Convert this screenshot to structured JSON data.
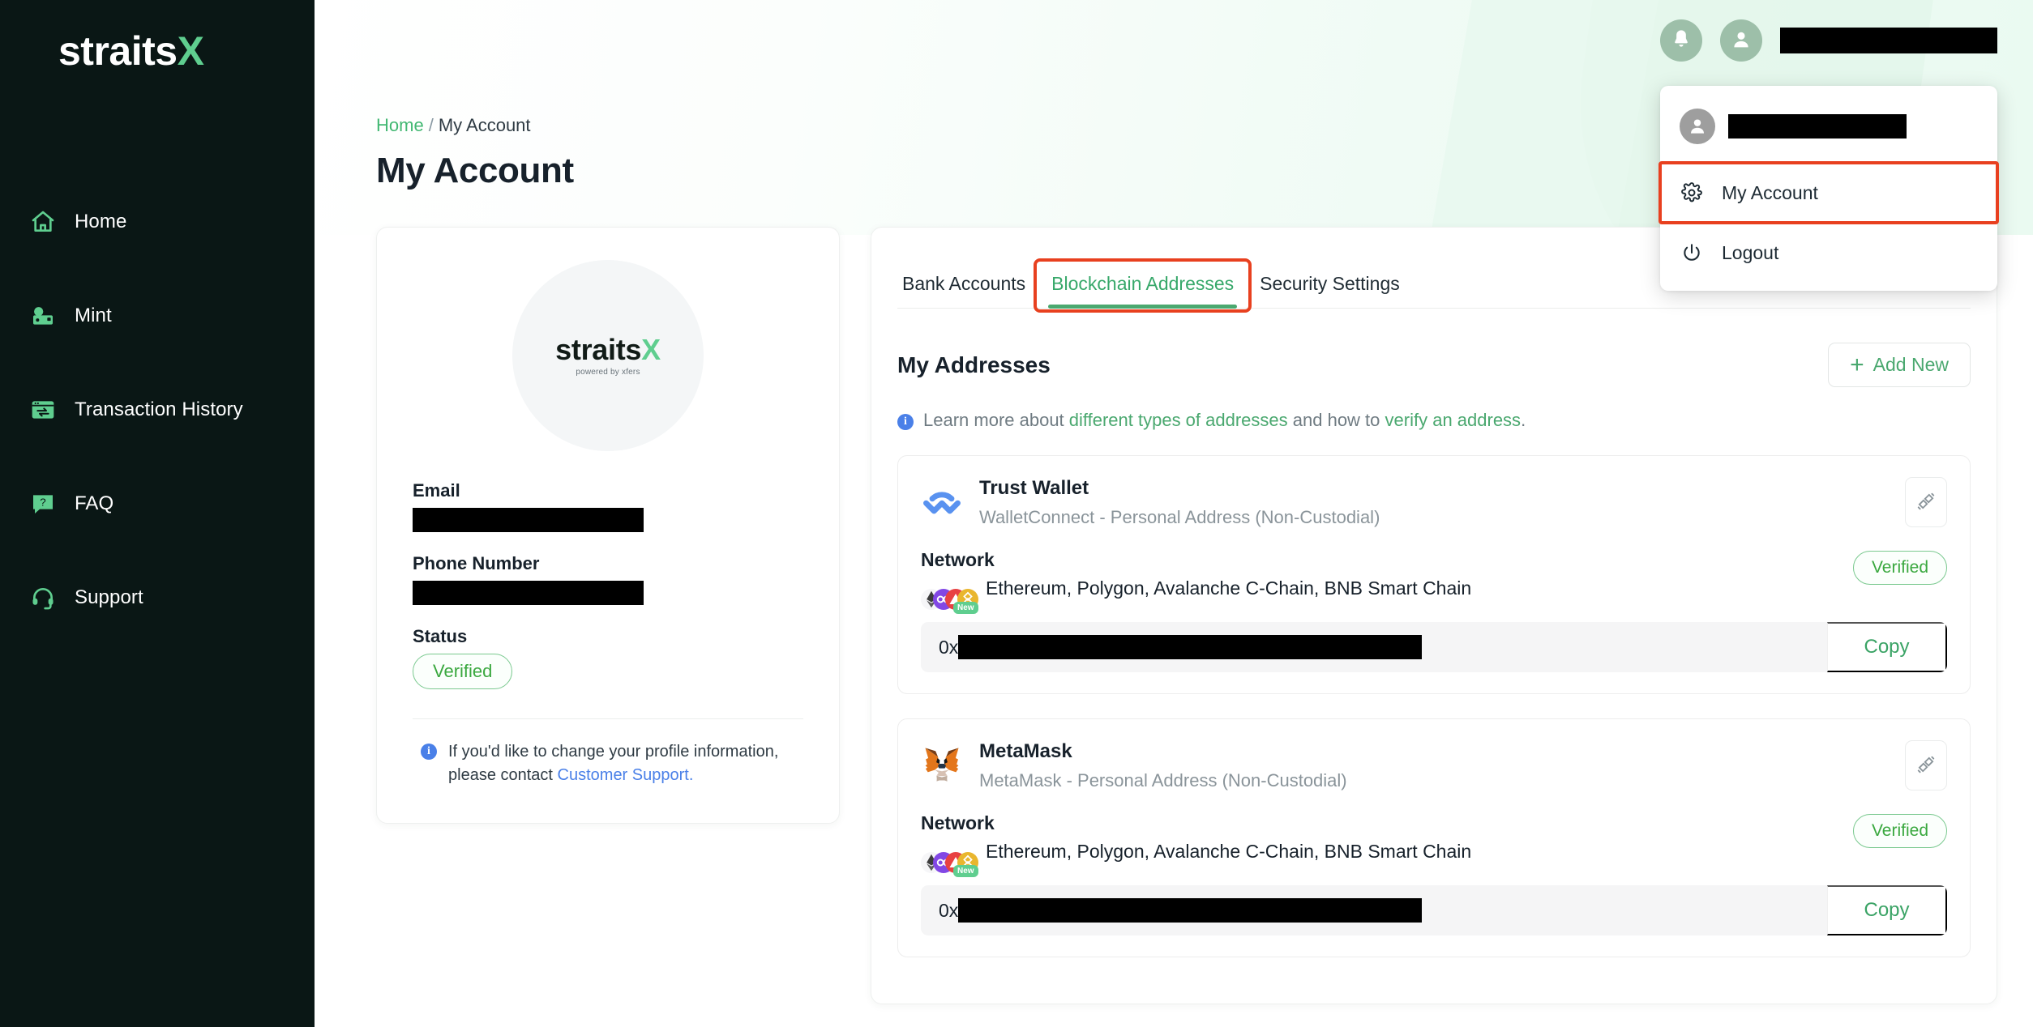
{
  "brand": {
    "logo_text": "straits",
    "logo_accent": "X",
    "avatar_logo_text": "straits",
    "avatar_logo_accent": "X",
    "avatar_tagline": "powered by xfers",
    "accent_green": "#5fce8f",
    "link_green": "#4aa86f",
    "highlight_red": "#e8401f",
    "sidebar_bg": "#0a1715"
  },
  "sidebar": {
    "items": [
      {
        "label": "Home",
        "icon": "home-icon"
      },
      {
        "label": "Mint",
        "icon": "money-icon"
      },
      {
        "label": "Transaction History",
        "icon": "transaction-history-icon"
      },
      {
        "label": "FAQ",
        "icon": "faq-icon"
      },
      {
        "label": "Support",
        "icon": "headset-icon"
      }
    ]
  },
  "topbar": {
    "notification_icon": "bell-icon",
    "profile_icon": "person-icon",
    "user_name": ""
  },
  "dropdown": {
    "avatar_icon": "person-icon",
    "user_name": "",
    "items": [
      {
        "label": "My Account",
        "icon": "gear-icon",
        "highlighted": true
      },
      {
        "label": "Logout",
        "icon": "power-icon",
        "highlighted": false
      }
    ]
  },
  "breadcrumb": {
    "home": "Home",
    "separator": "/",
    "current": "My Account"
  },
  "page_title": "My Account",
  "profile": {
    "email_label": "Email",
    "email_value": "",
    "phone_label": "Phone Number",
    "phone_value": "",
    "status_label": "Status",
    "status_value": "Verified",
    "note_prefix": "If you'd like to change your profile information, please contact ",
    "note_link": "Customer Support.",
    "info_icon": "info-icon"
  },
  "tabs": [
    {
      "label": "Bank Accounts",
      "active": false,
      "highlighted": false
    },
    {
      "label": "Blockchain Addresses",
      "active": true,
      "highlighted": true
    },
    {
      "label": "Security Settings",
      "active": false,
      "highlighted": false
    }
  ],
  "addresses": {
    "section_title": "My Addresses",
    "add_new_label": "Add New",
    "add_new_icon": "plus-icon",
    "learn_info_icon": "info-icon",
    "learn_text_1": "Learn more about ",
    "learn_link_1": "different types of addresses",
    "learn_text_2": " and how to ",
    "learn_link_2": "verify an address",
    "learn_text_3": ".",
    "network_label": "Network",
    "chains_text": "Ethereum, Polygon, Avalanche C-Chain, BNB Smart Chain",
    "chain_new_badge": "New",
    "address_prefix": "0x",
    "copy_label": "Copy",
    "verified_label": "Verified",
    "disconnect_icon": "disconnect-plug-icon",
    "wallets": [
      {
        "name": "Trust Wallet",
        "subtitle": "WalletConnect - Personal Address (Non-Custodial)",
        "logo": "walletconnect-icon",
        "status": "Verified",
        "address_prefix": "0x",
        "address_value": ""
      },
      {
        "name": "MetaMask",
        "subtitle": "MetaMask - Personal Address (Non-Custodial)",
        "logo": "metamask-fox-icon",
        "status": "Verified",
        "address_prefix": "0x",
        "address_value": ""
      }
    ]
  }
}
